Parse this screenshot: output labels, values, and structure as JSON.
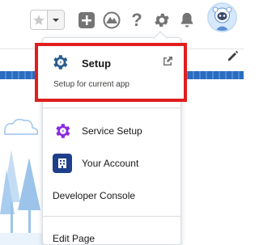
{
  "header": {
    "favorites_star_icon": "star-icon",
    "favorites_list_icon": "chevron-down-icon",
    "global_actions_icon": "plus-icon",
    "trailhead_icon": "trailhead-icon",
    "help_icon": "question-icon",
    "setup_icon": "gear-icon",
    "notifications_icon": "bell-icon",
    "help_glyph": "?"
  },
  "setup_menu": {
    "setup_item": {
      "label": "Setup",
      "subtitle": "Setup for current app",
      "icon": "setup-gear-icon",
      "external_icon": "external-link-icon"
    },
    "items": [
      {
        "label": "Service Setup",
        "icon": "service-setup-gear-icon",
        "color": "#8a2be2"
      },
      {
        "label": "Your Account",
        "icon": "building-icon",
        "color": "#1e3f8a"
      },
      {
        "label": "Developer Console"
      },
      {
        "label": "Edit Page"
      }
    ]
  },
  "colors": {
    "highlight_border": "#e01e1e",
    "banner_blue": "#2a6cbf",
    "icon_gray": "#747474"
  }
}
